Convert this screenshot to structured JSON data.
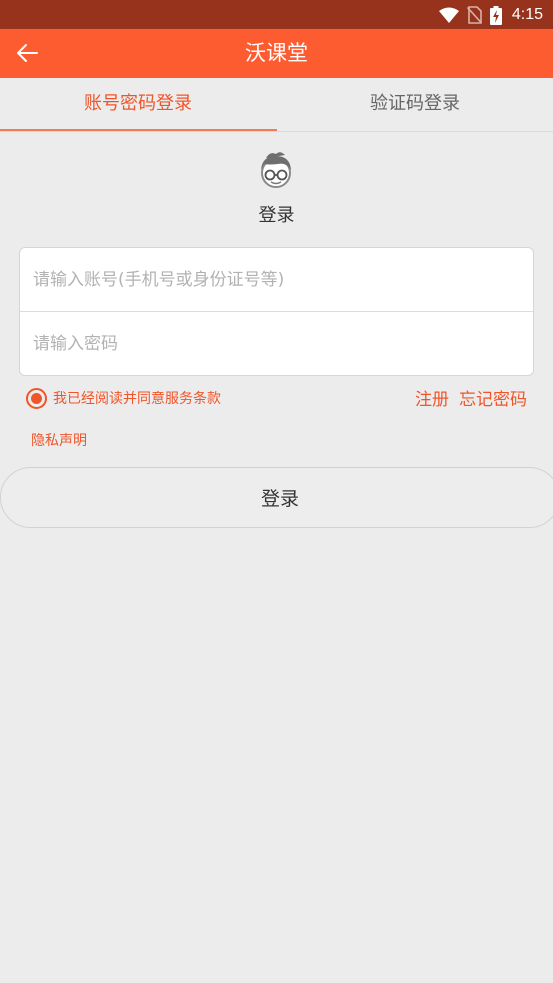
{
  "status_bar": {
    "time": "4:15"
  },
  "app_bar": {
    "title": "沃课堂"
  },
  "tabs": [
    {
      "label": "账号密码登录",
      "active": true
    },
    {
      "label": "验证码登录",
      "active": false
    }
  ],
  "login": {
    "heading": "登录",
    "account_placeholder": "请输入账号(手机号或身份证号等)",
    "password_placeholder": "请输入密码",
    "agree_text": "我已经阅读并同意服务条款",
    "register_link": "注册",
    "forgot_link": "忘记密码",
    "privacy_link": "隐私声明",
    "submit_label": "登录"
  },
  "colors": {
    "accent": "#fd5c31",
    "status_bar": "#97331c",
    "link": "#f0552a",
    "background": "#ececec"
  },
  "icons": {
    "back": "arrow-left-icon",
    "avatar": "avatar-glasses-icon",
    "wifi": "wifi-icon",
    "sim": "no-sim-icon",
    "battery": "battery-charging-icon"
  }
}
